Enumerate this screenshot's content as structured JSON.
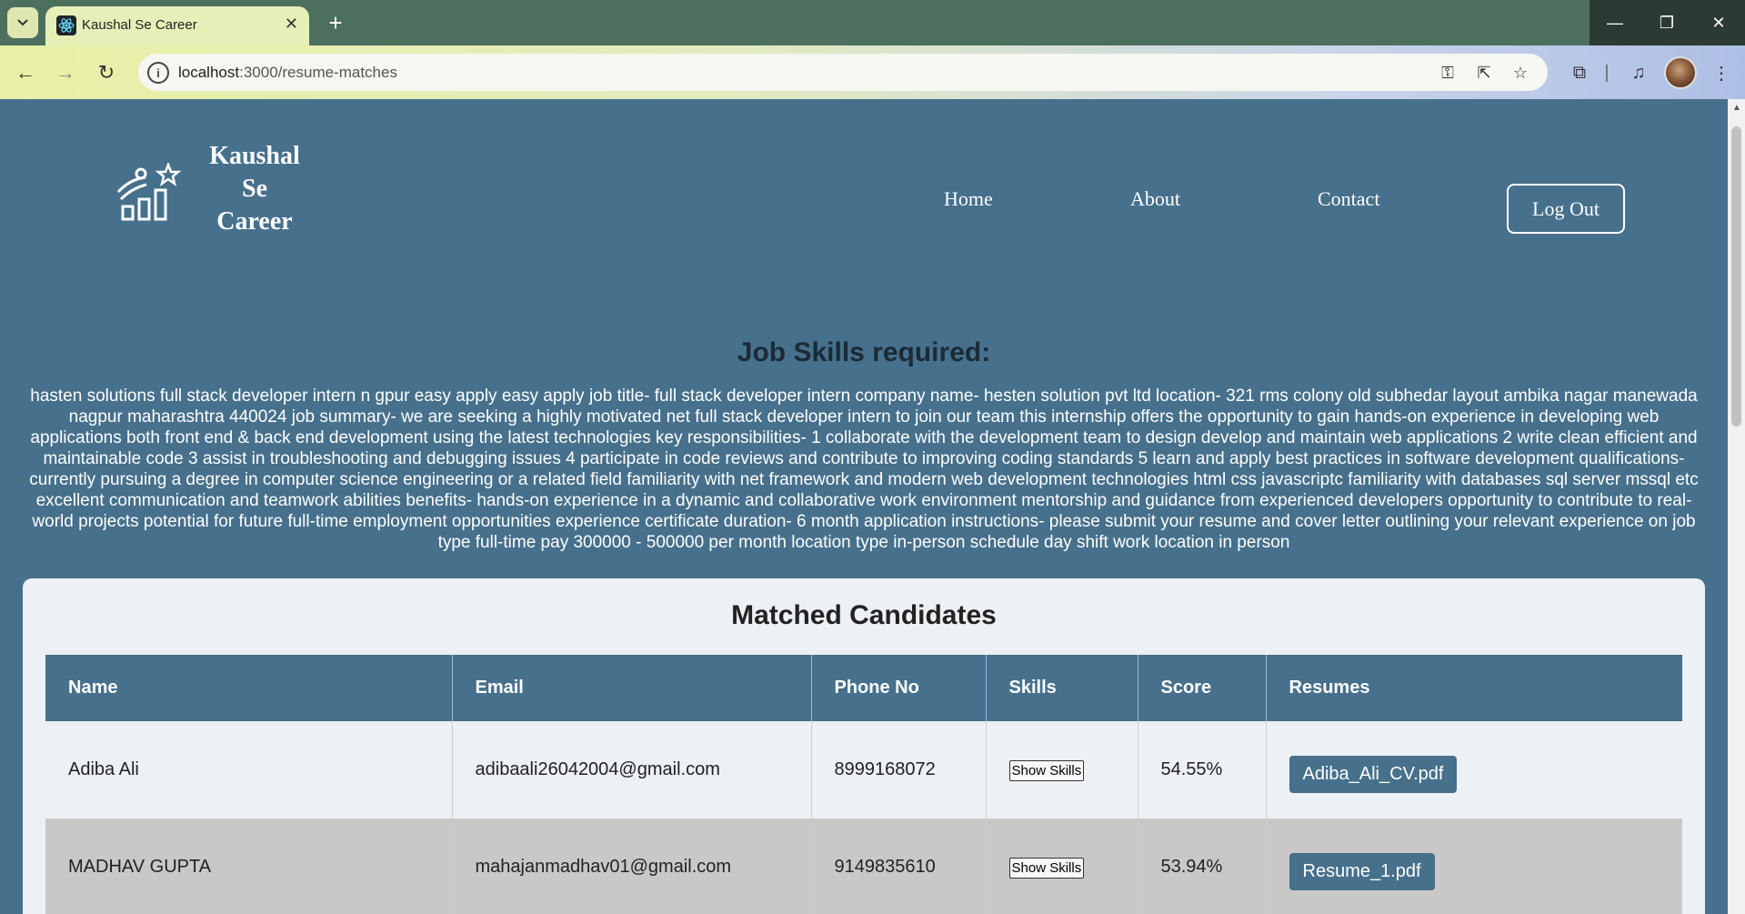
{
  "browser": {
    "tab_title": "Kaushal Se Career",
    "url_host": "localhost",
    "url_path": ":3000/resume-matches"
  },
  "header": {
    "brand_line1": "Kaushal",
    "brand_line2": "Se",
    "brand_line3": "Career",
    "nav": {
      "home": "Home",
      "about": "About",
      "contact": "Contact"
    },
    "logout_label": "Log Out"
  },
  "skills": {
    "heading": "Job Skills required:",
    "text": "hasten solutions full stack developer intern n gpur easy apply easy apply job title- full stack developer intern company name- hesten solution pvt ltd location- 321 rms colony old subhedar layout ambika nagar manewada nagpur maharashtra 440024 job summary- we are seeking a highly motivated net full stack developer intern to join our team this internship offers the opportunity to gain hands-on experience in developing web applications both front end & back end development using the latest technologies key responsibilities- 1 collaborate with the development team to design develop and maintain web applications 2 write clean efficient and maintainable code 3 assist in troubleshooting and debugging issues 4 participate in code reviews and contribute to improving coding standards 5 learn and apply best practices in software development qualifications- currently pursuing a degree in computer science engineering or a related field familiarity with net framework and modern web development technologies html css javascriptc familiarity with databases sql server mssql etc excellent communication and teamwork abilities benefits- hands-on experience in a dynamic and collaborative work environment mentorship and guidance from experienced developers opportunity to contribute to real-world projects potential for future full-time employment opportunities experience certificate duration- 6 month application instructions- please submit your resume and cover letter outlining your relevant experience on job type full-time pay 300000 - 500000 per month location type in-person schedule day shift work location in person"
  },
  "candidates": {
    "title": "Matched Candidates",
    "columns": {
      "name": "Name",
      "email": "Email",
      "phone": "Phone No",
      "skills": "Skills",
      "score": "Score",
      "resumes": "Resumes"
    },
    "rows": [
      {
        "name": "Adiba Ali",
        "email": "adibaali26042004@gmail.com",
        "phone": "8999168072",
        "skills_button": "Show Skills",
        "score": "54.55%",
        "resume": "Adiba_Ali_CV.pdf"
      },
      {
        "name": "MADHAV GUPTA",
        "email": "mahajanmadhav01@gmail.com",
        "phone": "9149835610",
        "skills_button": "Show Skills",
        "score": "53.94%",
        "resume": "Resume_1.pdf"
      }
    ]
  },
  "colors": {
    "page_bg": "#46708c",
    "card_bg": "#edf0f4",
    "row_alt_bg": "#cac8c7"
  }
}
